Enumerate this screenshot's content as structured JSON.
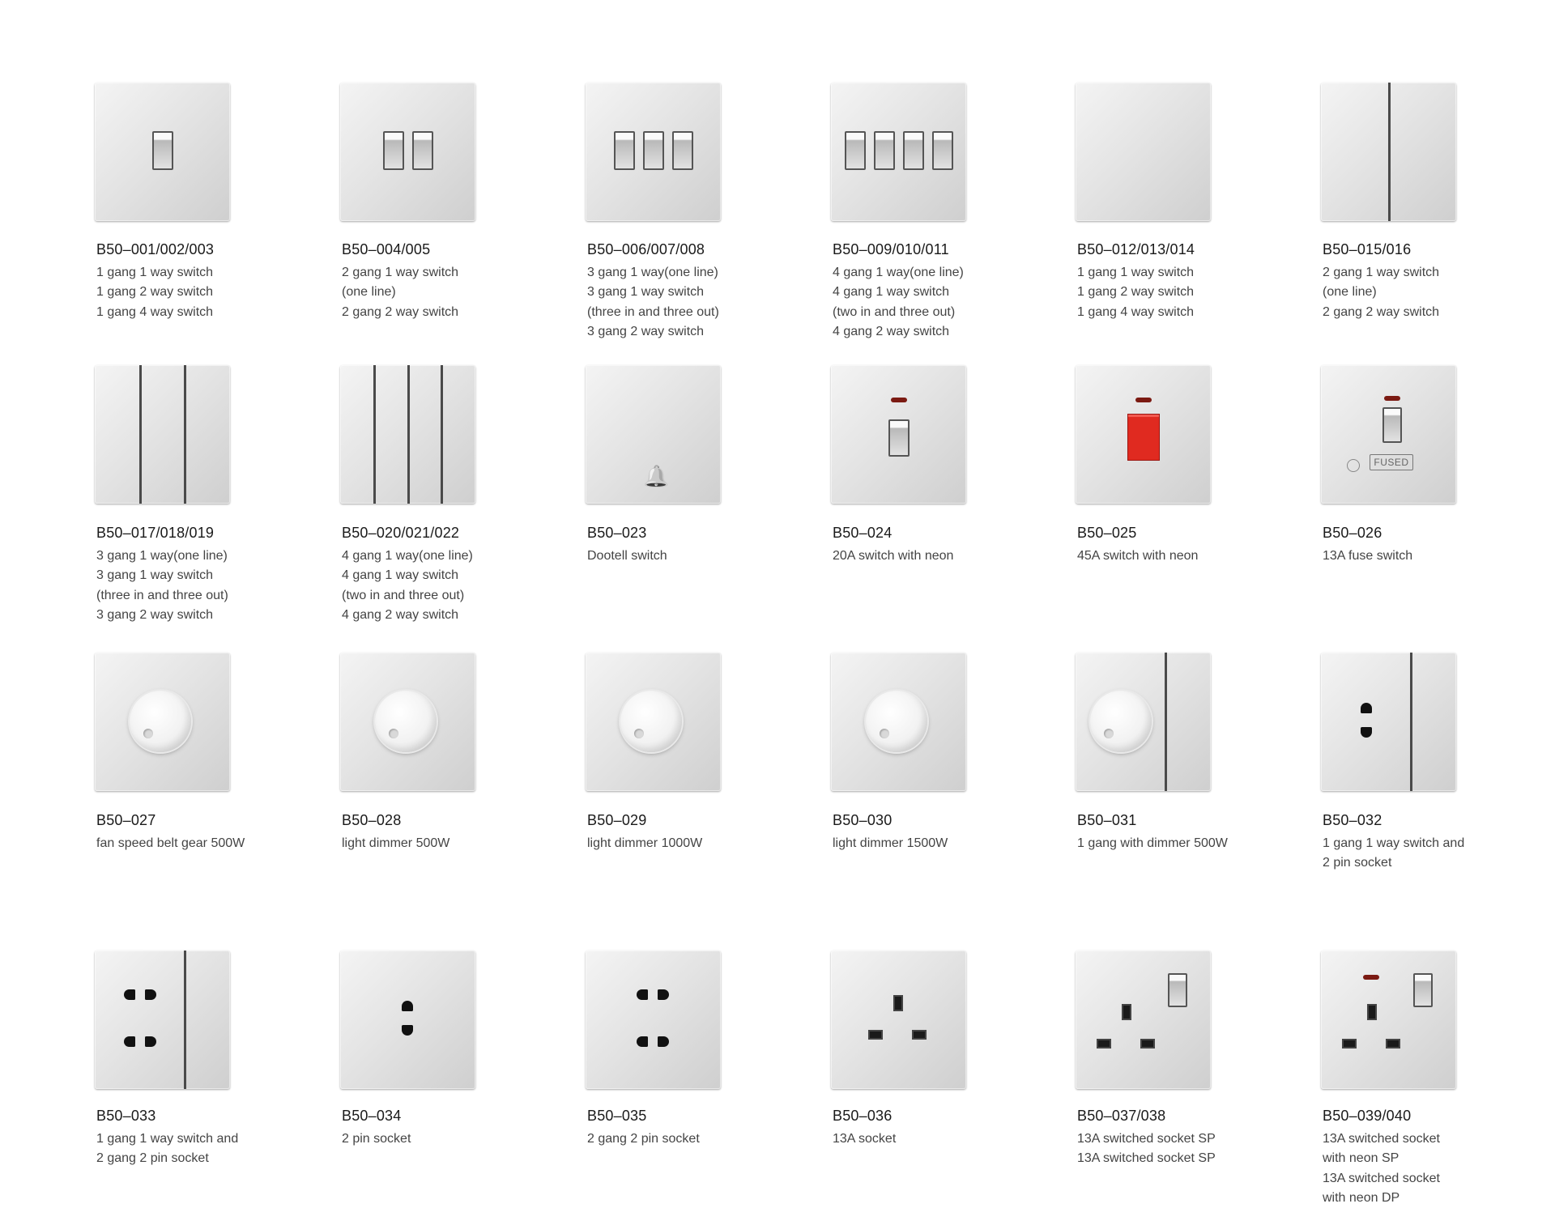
{
  "products": [
    {
      "code": "B50–001/002/003",
      "lines": [
        "1 gang 1 way switch",
        "1 gang 2 way switch",
        "1 gang 4 way switch"
      ],
      "face": "rocker-1"
    },
    {
      "code": "B50–004/005",
      "lines": [
        "2 gang 1 way switch",
        "(one line)",
        "2 gang 2 way switch"
      ],
      "face": "rocker-2"
    },
    {
      "code": "B50–006/007/008",
      "lines": [
        "3 gang 1 way(one line)",
        "3 gang 1 way switch",
        "(three in and three out)",
        "3 gang 2 way switch"
      ],
      "face": "rocker-3"
    },
    {
      "code": "B50–009/010/011",
      "lines": [
        "4 gang 1 way(one line)",
        "4 gang 1 way switch",
        "(two in and three out)",
        "4 gang 2 way switch"
      ],
      "face": "rocker-4"
    },
    {
      "code": "B50–012/013/014",
      "lines": [
        "1 gang 1 way switch",
        "1 gang 2 way switch",
        "1 gang 4 way switch"
      ],
      "face": "blank"
    },
    {
      "code": "B50–015/016",
      "lines": [
        "2 gang 1 way switch",
        "(one line)",
        "2 gang 2 way switch"
      ],
      "face": "split-2"
    },
    {
      "code": "B50–017/018/019",
      "lines": [
        "3 gang 1 way(one line)",
        "3 gang 1 way switch",
        "(three in and three out)",
        "3 gang 2 way switch"
      ],
      "face": "split-3"
    },
    {
      "code": "B50–020/021/022",
      "lines": [
        "4 gang 1 way(one line)",
        "4 gang 1 way switch",
        "(two in and three out)",
        "4 gang 2 way switch"
      ],
      "face": "split-4"
    },
    {
      "code": "B50–023",
      "lines": [
        "Dootell switch"
      ],
      "face": "bell"
    },
    {
      "code": "B50–024",
      "lines": [
        "20A switch with neon"
      ],
      "face": "neon-rocker"
    },
    {
      "code": "B50–025",
      "lines": [
        "45A switch with neon"
      ],
      "face": "neon-red"
    },
    {
      "code": "B50–026",
      "lines": [
        "13A fuse switch"
      ],
      "face": "fuse"
    },
    {
      "code": "B50–027",
      "lines": [
        "fan speed belt gear 500W"
      ],
      "face": "knob"
    },
    {
      "code": "B50–028",
      "lines": [
        "light dimmer 500W"
      ],
      "face": "knob"
    },
    {
      "code": "B50–029",
      "lines": [
        "light dimmer 1000W"
      ],
      "face": "knob"
    },
    {
      "code": "B50–030",
      "lines": [
        "light dimmer 1500W"
      ],
      "face": "knob"
    },
    {
      "code": "B50–031",
      "lines": [
        "1 gang with dimmer 500W"
      ],
      "face": "knob-split"
    },
    {
      "code": "B50–032",
      "lines": [
        "1 gang 1 way switch and",
        "2 pin socket"
      ],
      "face": "pin2-split"
    },
    {
      "code": "B50–033",
      "lines": [
        "1 gang 1 way switch and",
        "2 gang 2 pin socket"
      ],
      "face": "pin4-split"
    },
    {
      "code": "B50–034",
      "lines": [
        "2 pin socket"
      ],
      "face": "pin2"
    },
    {
      "code": "B50–035",
      "lines": [
        "2 gang 2 pin socket"
      ],
      "face": "pin4"
    },
    {
      "code": "B50–036",
      "lines": [
        "13A socket"
      ],
      "face": "uk"
    },
    {
      "code": "B50–037/038",
      "lines": [
        "13A switched socket SP",
        "13A switched socket SP"
      ],
      "face": "uk-switch"
    },
    {
      "code": "B50–039/040",
      "lines": [
        "13A switched socket",
        "with neon SP",
        "13A switched socket",
        "with neon DP"
      ],
      "face": "uk-switch-neon"
    }
  ],
  "icons": {
    "bell": "bell-icon",
    "fused_label": "FUSED"
  },
  "colors": {
    "neon": "#7b1a12",
    "red_switch": "#e02a20",
    "plate": "#e4e4e4"
  }
}
